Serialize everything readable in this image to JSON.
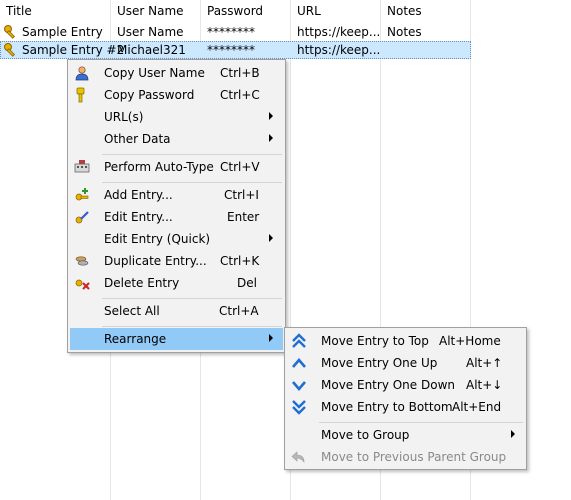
{
  "table": {
    "headers": [
      "Title",
      "User Name",
      "Password",
      "URL",
      "Notes"
    ],
    "rows": [
      {
        "title": "Sample Entry",
        "username": "User Name",
        "password": "********",
        "url": "https://keep...",
        "notes": "Notes"
      },
      {
        "title": "Sample Entry #2",
        "username": "Michael321",
        "password": "********",
        "url": "https://keep...",
        "notes": ""
      }
    ]
  },
  "context_menu": {
    "items": [
      {
        "label": "Copy User Name",
        "shortcut": "Ctrl+B",
        "icon": "user-icon"
      },
      {
        "label": "Copy Password",
        "shortcut": "Ctrl+C",
        "icon": "key-icon"
      },
      {
        "label": "URL(s)",
        "submenu": true
      },
      {
        "label": "Other Data",
        "submenu": true
      },
      {
        "label": "Perform Auto-Type",
        "shortcut": "Ctrl+V",
        "icon": "keyboard-icon"
      },
      {
        "label": "Add Entry...",
        "shortcut": "Ctrl+I",
        "icon": "add-entry-icon"
      },
      {
        "label": "Edit Entry...",
        "shortcut": "Enter",
        "icon": "edit-entry-icon"
      },
      {
        "label": "Edit Entry (Quick)",
        "submenu": true
      },
      {
        "label": "Duplicate Entry...",
        "shortcut": "Ctrl+K",
        "icon": "duplicate-entry-icon"
      },
      {
        "label": "Delete Entry",
        "shortcut": "Del",
        "icon": "delete-entry-icon"
      },
      {
        "label": "Select All",
        "shortcut": "Ctrl+A"
      },
      {
        "label": "Rearrange",
        "submenu": true,
        "highlighted": true
      }
    ]
  },
  "rearrange_submenu": {
    "items": [
      {
        "label": "Move Entry to Top",
        "shortcut": "Alt+Home",
        "icon": "move-top-icon"
      },
      {
        "label": "Move Entry One Up",
        "shortcut": "Alt+↑",
        "icon": "move-up-icon"
      },
      {
        "label": "Move Entry One Down",
        "shortcut": "Alt+↓",
        "icon": "move-down-icon"
      },
      {
        "label": "Move Entry to Bottom",
        "shortcut": "Alt+End",
        "icon": "move-bottom-icon"
      },
      {
        "label": "Move to Group",
        "submenu": true
      },
      {
        "label": "Move to Previous Parent Group",
        "disabled": true,
        "icon": "back-arrow-icon"
      }
    ]
  },
  "colors": {
    "highlight": "#91c9f7",
    "selection": "#cce8ff",
    "menu_bg": "#f2f2f2",
    "accent_blue": "#1f6fd1"
  }
}
